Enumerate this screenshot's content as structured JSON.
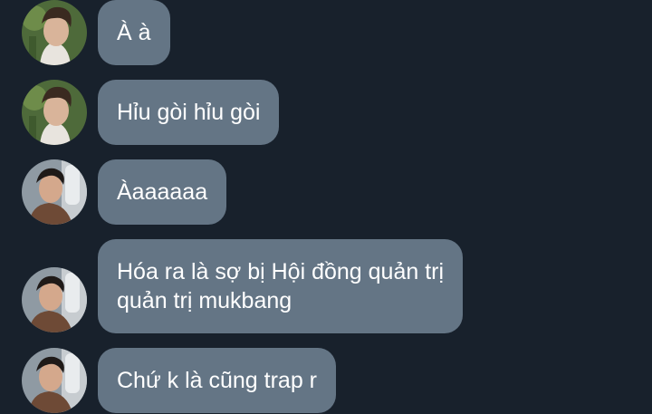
{
  "conversation": {
    "messages": [
      {
        "sender": "user-a",
        "lines": [
          "À à"
        ]
      },
      {
        "sender": "user-a",
        "lines": [
          "Hỉu gòi hỉu gòi"
        ]
      },
      {
        "sender": "user-b",
        "lines": [
          "Àaaaaaa"
        ]
      },
      {
        "sender": "user-b",
        "lines": [
          "Hóa ra là sợ bị Hội đồng quản trị",
          "quản trị mukbang"
        ]
      },
      {
        "sender": "user-b",
        "lines": [
          "Chứ k là cũng trap r"
        ]
      }
    ]
  },
  "colors": {
    "background": "#18212c",
    "bubble": "#647585",
    "text": "#ffffff"
  }
}
